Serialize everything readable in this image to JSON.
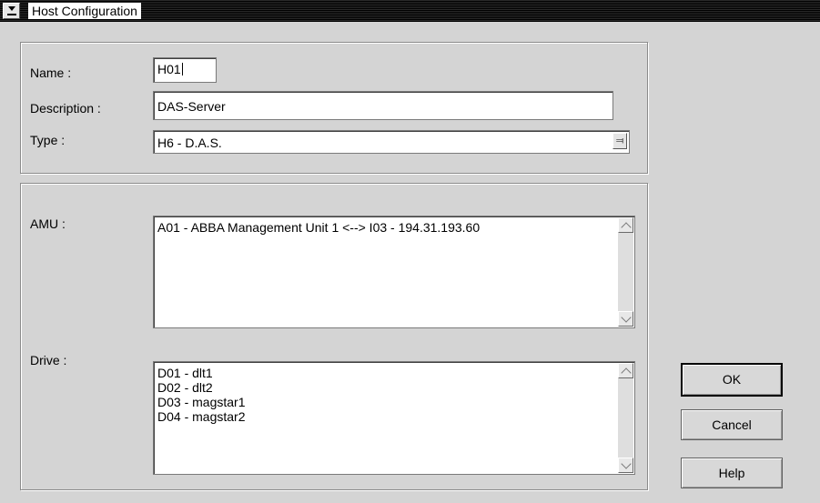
{
  "window": {
    "title": "Host Configuration"
  },
  "form": {
    "name_label": "Name :",
    "name_value": "H01",
    "description_label": "Description :",
    "description_value": "DAS-Server",
    "type_label": "Type :",
    "type_value": "H6  -  D.A.S."
  },
  "amu": {
    "label": "AMU :",
    "items": [
      "A01  -  ABBA Management Unit 1  <-->  I03  -  194.31.193.60"
    ]
  },
  "drive": {
    "label": "Drive :",
    "items": [
      "D01  -  dlt1",
      "D02  -  dlt2",
      "D03  -  magstar1",
      "D04  -  magstar2"
    ]
  },
  "buttons": {
    "ok": "OK",
    "cancel": "Cancel",
    "help": "Help"
  },
  "icons": {
    "system_menu": "chevron-down-icon",
    "combo": "double-chevron-down-icon",
    "scroll_up": "chevron-up-icon",
    "scroll_down": "chevron-down-icon"
  }
}
